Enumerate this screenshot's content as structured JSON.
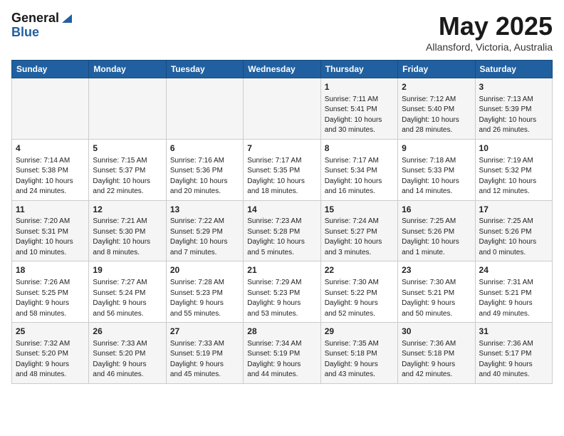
{
  "header": {
    "logo_general": "General",
    "logo_blue": "Blue",
    "month_title": "May 2025",
    "subtitle": "Allansford, Victoria, Australia"
  },
  "days_of_week": [
    "Sunday",
    "Monday",
    "Tuesday",
    "Wednesday",
    "Thursday",
    "Friday",
    "Saturday"
  ],
  "weeks": [
    [
      {
        "day": "",
        "info": ""
      },
      {
        "day": "",
        "info": ""
      },
      {
        "day": "",
        "info": ""
      },
      {
        "day": "",
        "info": ""
      },
      {
        "day": "1",
        "info": "Sunrise: 7:11 AM\nSunset: 5:41 PM\nDaylight: 10 hours\nand 30 minutes."
      },
      {
        "day": "2",
        "info": "Sunrise: 7:12 AM\nSunset: 5:40 PM\nDaylight: 10 hours\nand 28 minutes."
      },
      {
        "day": "3",
        "info": "Sunrise: 7:13 AM\nSunset: 5:39 PM\nDaylight: 10 hours\nand 26 minutes."
      }
    ],
    [
      {
        "day": "4",
        "info": "Sunrise: 7:14 AM\nSunset: 5:38 PM\nDaylight: 10 hours\nand 24 minutes."
      },
      {
        "day": "5",
        "info": "Sunrise: 7:15 AM\nSunset: 5:37 PM\nDaylight: 10 hours\nand 22 minutes."
      },
      {
        "day": "6",
        "info": "Sunrise: 7:16 AM\nSunset: 5:36 PM\nDaylight: 10 hours\nand 20 minutes."
      },
      {
        "day": "7",
        "info": "Sunrise: 7:17 AM\nSunset: 5:35 PM\nDaylight: 10 hours\nand 18 minutes."
      },
      {
        "day": "8",
        "info": "Sunrise: 7:17 AM\nSunset: 5:34 PM\nDaylight: 10 hours\nand 16 minutes."
      },
      {
        "day": "9",
        "info": "Sunrise: 7:18 AM\nSunset: 5:33 PM\nDaylight: 10 hours\nand 14 minutes."
      },
      {
        "day": "10",
        "info": "Sunrise: 7:19 AM\nSunset: 5:32 PM\nDaylight: 10 hours\nand 12 minutes."
      }
    ],
    [
      {
        "day": "11",
        "info": "Sunrise: 7:20 AM\nSunset: 5:31 PM\nDaylight: 10 hours\nand 10 minutes."
      },
      {
        "day": "12",
        "info": "Sunrise: 7:21 AM\nSunset: 5:30 PM\nDaylight: 10 hours\nand 8 minutes."
      },
      {
        "day": "13",
        "info": "Sunrise: 7:22 AM\nSunset: 5:29 PM\nDaylight: 10 hours\nand 7 minutes."
      },
      {
        "day": "14",
        "info": "Sunrise: 7:23 AM\nSunset: 5:28 PM\nDaylight: 10 hours\nand 5 minutes."
      },
      {
        "day": "15",
        "info": "Sunrise: 7:24 AM\nSunset: 5:27 PM\nDaylight: 10 hours\nand 3 minutes."
      },
      {
        "day": "16",
        "info": "Sunrise: 7:25 AM\nSunset: 5:26 PM\nDaylight: 10 hours\nand 1 minute."
      },
      {
        "day": "17",
        "info": "Sunrise: 7:25 AM\nSunset: 5:26 PM\nDaylight: 10 hours\nand 0 minutes."
      }
    ],
    [
      {
        "day": "18",
        "info": "Sunrise: 7:26 AM\nSunset: 5:25 PM\nDaylight: 9 hours\nand 58 minutes."
      },
      {
        "day": "19",
        "info": "Sunrise: 7:27 AM\nSunset: 5:24 PM\nDaylight: 9 hours\nand 56 minutes."
      },
      {
        "day": "20",
        "info": "Sunrise: 7:28 AM\nSunset: 5:23 PM\nDaylight: 9 hours\nand 55 minutes."
      },
      {
        "day": "21",
        "info": "Sunrise: 7:29 AM\nSunset: 5:23 PM\nDaylight: 9 hours\nand 53 minutes."
      },
      {
        "day": "22",
        "info": "Sunrise: 7:30 AM\nSunset: 5:22 PM\nDaylight: 9 hours\nand 52 minutes."
      },
      {
        "day": "23",
        "info": "Sunrise: 7:30 AM\nSunset: 5:21 PM\nDaylight: 9 hours\nand 50 minutes."
      },
      {
        "day": "24",
        "info": "Sunrise: 7:31 AM\nSunset: 5:21 PM\nDaylight: 9 hours\nand 49 minutes."
      }
    ],
    [
      {
        "day": "25",
        "info": "Sunrise: 7:32 AM\nSunset: 5:20 PM\nDaylight: 9 hours\nand 48 minutes."
      },
      {
        "day": "26",
        "info": "Sunrise: 7:33 AM\nSunset: 5:20 PM\nDaylight: 9 hours\nand 46 minutes."
      },
      {
        "day": "27",
        "info": "Sunrise: 7:33 AM\nSunset: 5:19 PM\nDaylight: 9 hours\nand 45 minutes."
      },
      {
        "day": "28",
        "info": "Sunrise: 7:34 AM\nSunset: 5:19 PM\nDaylight: 9 hours\nand 44 minutes."
      },
      {
        "day": "29",
        "info": "Sunrise: 7:35 AM\nSunset: 5:18 PM\nDaylight: 9 hours\nand 43 minutes."
      },
      {
        "day": "30",
        "info": "Sunrise: 7:36 AM\nSunset: 5:18 PM\nDaylight: 9 hours\nand 42 minutes."
      },
      {
        "day": "31",
        "info": "Sunrise: 7:36 AM\nSunset: 5:17 PM\nDaylight: 9 hours\nand 40 minutes."
      }
    ]
  ]
}
